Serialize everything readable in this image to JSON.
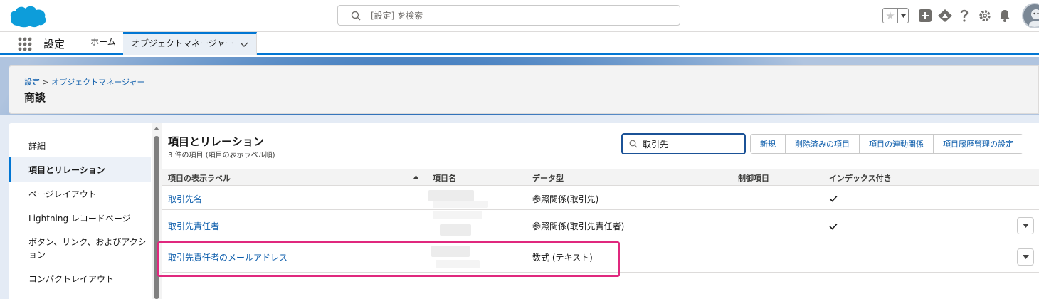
{
  "header": {
    "search_placeholder": "[設定] を検索"
  },
  "app_nav": {
    "app_name": "設定",
    "home_label": "ホーム",
    "tab_label": "オブジェクトマネージャー"
  },
  "page_header": {
    "breadcrumb_root": "設定",
    "breadcrumb_separator": ">",
    "breadcrumb_current": "オブジェクトマネージャー",
    "title": "商談"
  },
  "sidebar": {
    "items": [
      {
        "label": "詳細",
        "active": false
      },
      {
        "label": "項目とリレーション",
        "active": true
      },
      {
        "label": "ページレイアウト",
        "active": false
      },
      {
        "label": "Lightning レコードページ",
        "active": false
      },
      {
        "label": "ボタン、リンク、およびアクション",
        "active": false
      },
      {
        "label": "コンパクトレイアウト",
        "active": false
      }
    ]
  },
  "main": {
    "title": "項目とリレーション",
    "subtitle": "3 件の項目 (項目の表示ラベル順)",
    "filter_value": "取引先",
    "buttons": [
      "新規",
      "削除済みの項目",
      "項目の連動関係",
      "項目履歴管理の設定"
    ],
    "columns": [
      "項目の表示ラベル",
      "項目名",
      "データ型",
      "制御項目",
      "インデックス付き"
    ],
    "rows": [
      {
        "label": "取引先名",
        "type": "参照関係(取引先)",
        "indexed": true,
        "has_menu": false
      },
      {
        "label": "取引先責任者",
        "type": "参照関係(取引先責任者)",
        "indexed": true,
        "has_menu": true
      },
      {
        "label": "取引先責任者のメールアドレス",
        "type": "数式 (テキスト)",
        "indexed": false,
        "has_menu": true
      }
    ]
  },
  "colors": {
    "brand": "#0176d3",
    "link": "#0b5cab",
    "highlight": "#e0287e"
  }
}
